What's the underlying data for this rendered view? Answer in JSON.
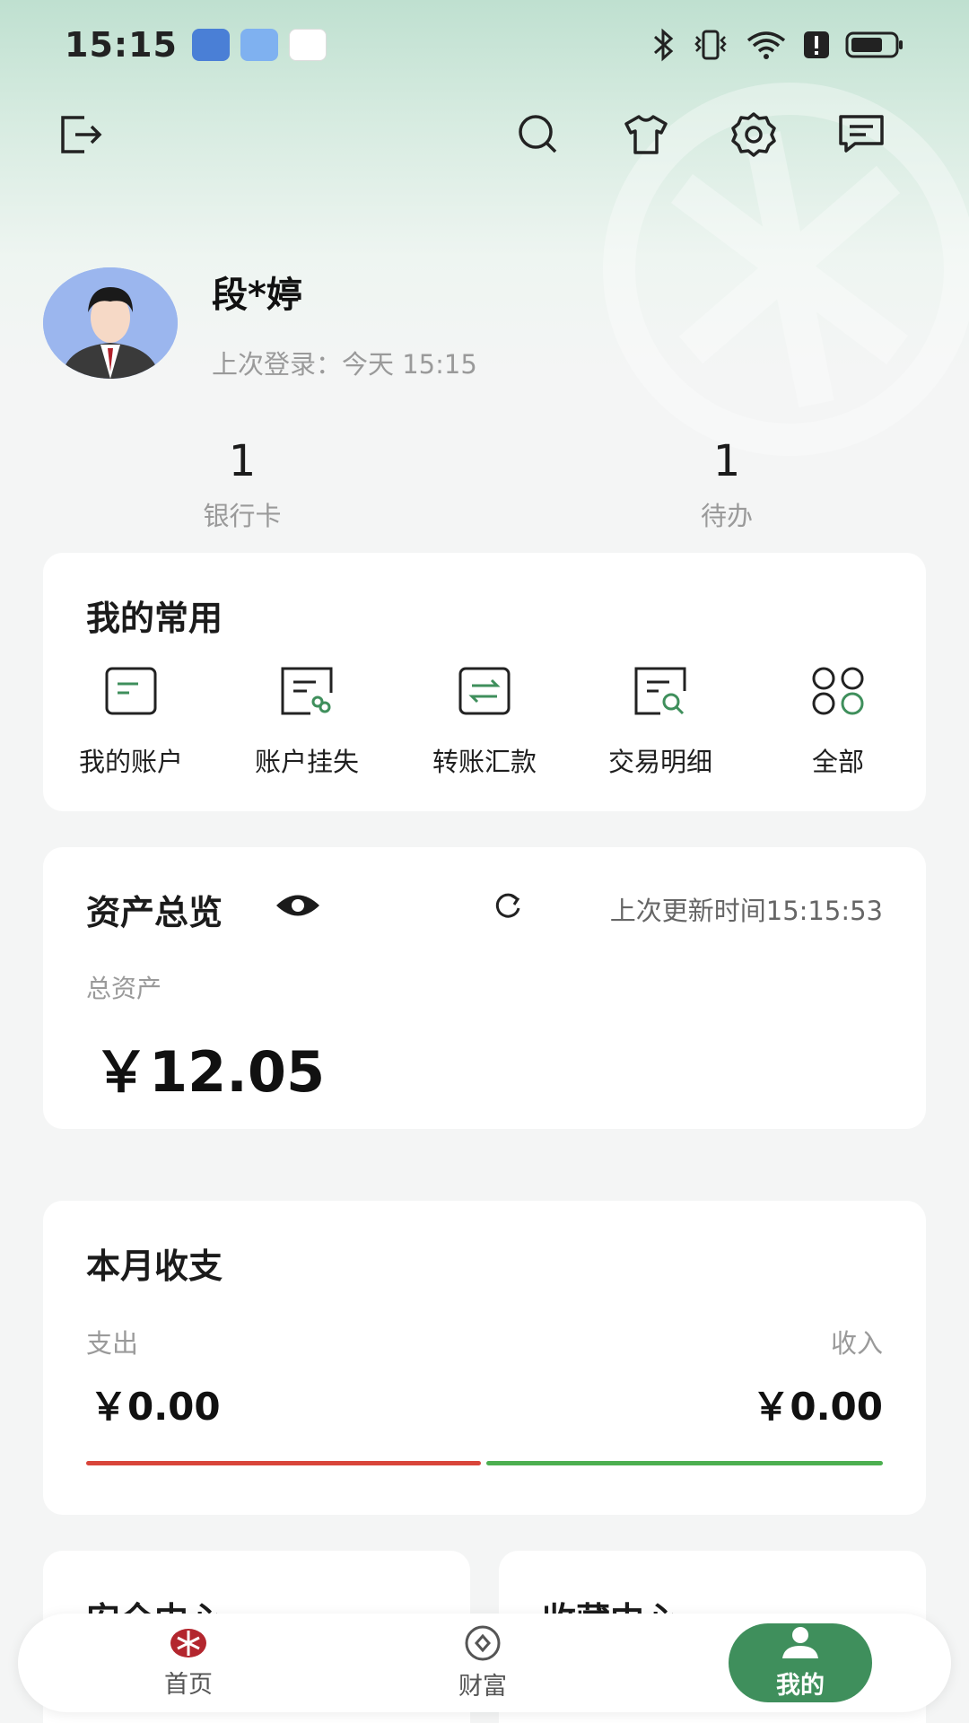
{
  "status_bar": {
    "time": "15:15",
    "icons": [
      "app-icon-blue",
      "weather-icon",
      "browser-icon",
      "bluetooth-icon",
      "vibrate-icon",
      "wifi-icon",
      "alert-icon",
      "battery-icon"
    ]
  },
  "toolbar": {
    "icons": [
      "logout-icon",
      "search-icon",
      "skin-icon",
      "settings-icon",
      "message-icon"
    ]
  },
  "profile": {
    "name": "段*婷",
    "last_login": "上次登录：今天 15:15"
  },
  "stats": [
    {
      "value": "1",
      "label": "银行卡"
    },
    {
      "value": "1",
      "label": "待办"
    }
  ],
  "favorites": {
    "title": "我的常用",
    "items": [
      {
        "label": "我的账户",
        "icon": "account-icon"
      },
      {
        "label": "账户挂失",
        "icon": "report-loss-icon"
      },
      {
        "label": "转账汇款",
        "icon": "transfer-icon"
      },
      {
        "label": "交易明细",
        "icon": "transaction-detail-icon"
      },
      {
        "label": "全部",
        "icon": "all-apps-icon"
      }
    ]
  },
  "assets": {
    "title": "资产总览",
    "updated": "上次更新时间15:15:53",
    "total_label": "总资产",
    "total_value": "￥12.05"
  },
  "monthly": {
    "title": "本月收支",
    "expense_label": "支出",
    "income_label": "收入",
    "expense_value": "￥0.00",
    "income_value": "￥0.00",
    "expense_color": "#d9453a",
    "income_color": "#4caf50"
  },
  "bottom_cards": {
    "left_title": "安全中心",
    "right_title": "收藏中心"
  },
  "tabbar": {
    "items": [
      {
        "label": "首页",
        "icon": "home-icon"
      },
      {
        "label": "财富",
        "icon": "wealth-icon"
      },
      {
        "label": "我的",
        "icon": "profile-icon",
        "active": true
      }
    ],
    "accent": "#3f8f5c"
  }
}
